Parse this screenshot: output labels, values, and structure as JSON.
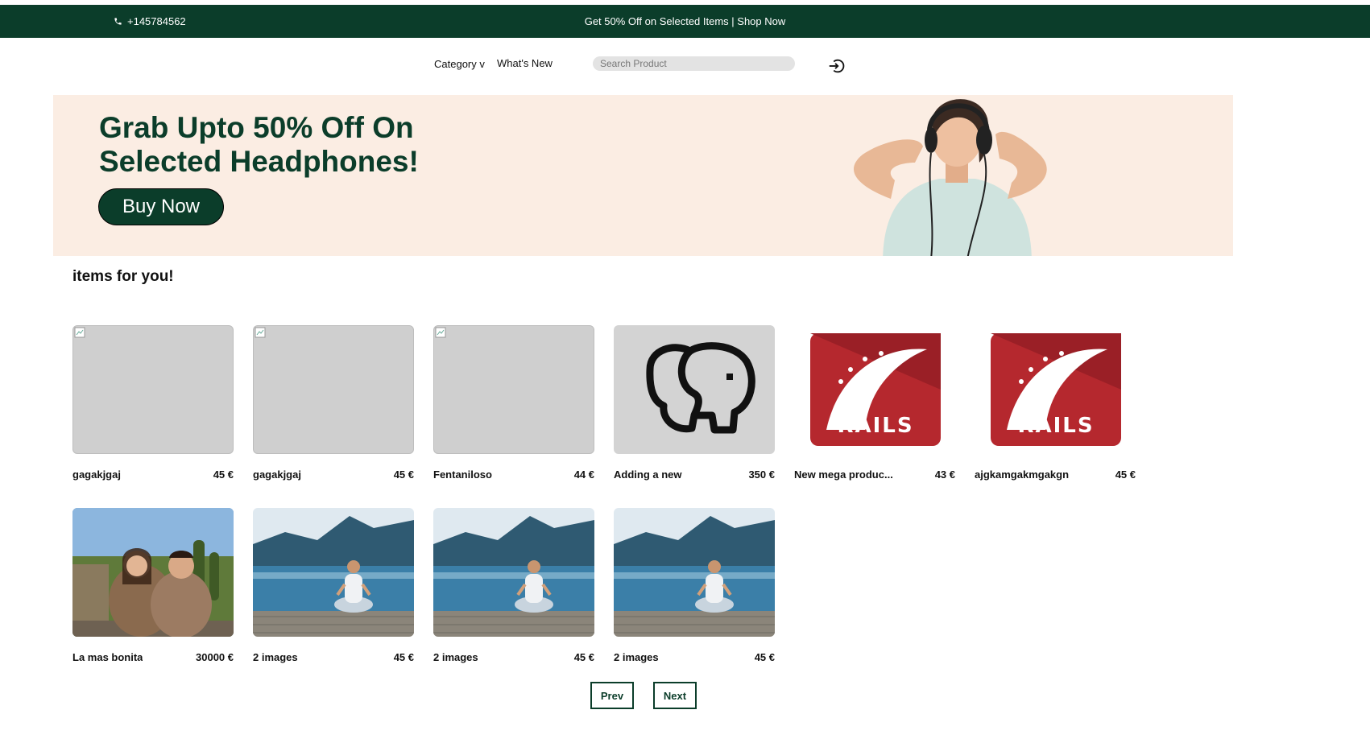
{
  "topbar": {
    "phone": "+145784562",
    "promo": "Get 50% Off on Selected Items | Shop Now",
    "icon": "phone-icon"
  },
  "nav": {
    "category": "Category v",
    "whats_new": "What's New",
    "search_placeholder": "Search Product",
    "login_icon": "login-icon"
  },
  "hero": {
    "title": "Grab Upto 50% Off On Selected Headphones!",
    "button": "Buy Now",
    "background": "#fbede3",
    "accent": "#0b3d2a"
  },
  "section": {
    "title": "items for you!"
  },
  "products": [
    {
      "name": "gagakjgaj",
      "price": "45 €",
      "image": "broken-image"
    },
    {
      "name": "gagakjgaj",
      "price": "45 €",
      "image": "broken-image"
    },
    {
      "name": "Fentaniloso",
      "price": "44 €",
      "image": "broken-image"
    },
    {
      "name": "Adding a new",
      "price": "350 €",
      "image": "elephant-logo"
    },
    {
      "name": "New mega produc...",
      "price": "43 €",
      "image": "rails-logo"
    },
    {
      "name": "ajgkamgakmgakgn",
      "price": "45 €",
      "image": "rails-logo"
    },
    {
      "name": "La mas bonita",
      "price": "30000 €",
      "image": "couple-photo"
    },
    {
      "name": "2 images",
      "price": "45 €",
      "image": "lake-meditation-photo"
    },
    {
      "name": "2 images",
      "price": "45 €",
      "image": "lake-meditation-photo"
    },
    {
      "name": "2 images",
      "price": "45 €",
      "image": "lake-meditation-photo"
    }
  ],
  "pagination": {
    "prev": "Prev",
    "next": "Next"
  }
}
